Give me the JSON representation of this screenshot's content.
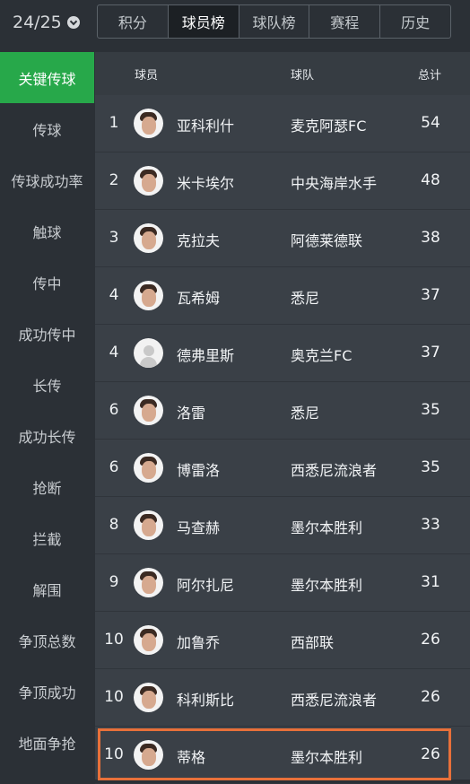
{
  "season": {
    "label": "24/25"
  },
  "tabs": [
    {
      "label": "积分"
    },
    {
      "label": "球员榜"
    },
    {
      "label": "球队榜"
    },
    {
      "label": "赛程"
    },
    {
      "label": "历史"
    }
  ],
  "active_tab": 1,
  "sidebar": {
    "items": [
      {
        "label": "关键传球"
      },
      {
        "label": "传球"
      },
      {
        "label": "传球成功率"
      },
      {
        "label": "触球"
      },
      {
        "label": "传中"
      },
      {
        "label": "成功传中"
      },
      {
        "label": "长传"
      },
      {
        "label": "成功长传"
      },
      {
        "label": "抢断"
      },
      {
        "label": "拦截"
      },
      {
        "label": "解围"
      },
      {
        "label": "争顶总数"
      },
      {
        "label": "争顶成功"
      },
      {
        "label": "地面争抢"
      }
    ]
  },
  "table": {
    "headers": {
      "player": "球员",
      "team": "球队",
      "total": "总计"
    },
    "rows": [
      {
        "rank": "1",
        "name": "亚科利什",
        "team": "麦克阿瑟FC",
        "total": "54"
      },
      {
        "rank": "2",
        "name": "米卡埃尔",
        "team": "中央海岸水手",
        "total": "48"
      },
      {
        "rank": "3",
        "name": "克拉夫",
        "team": "阿德莱德联",
        "total": "38"
      },
      {
        "rank": "4",
        "name": "瓦希姆",
        "team": "悉尼",
        "total": "37"
      },
      {
        "rank": "4",
        "name": "德弗里斯",
        "team": "奥克兰FC",
        "total": "37"
      },
      {
        "rank": "6",
        "name": "洛雷",
        "team": "悉尼",
        "total": "35"
      },
      {
        "rank": "6",
        "name": "博雷洛",
        "team": "西悉尼流浪者",
        "total": "35"
      },
      {
        "rank": "8",
        "name": "马查赫",
        "team": "墨尔本胜利",
        "total": "33"
      },
      {
        "rank": "9",
        "name": "阿尔扎尼",
        "team": "墨尔本胜利",
        "total": "31"
      },
      {
        "rank": "10",
        "name": "加鲁乔",
        "team": "西部联",
        "total": "26"
      },
      {
        "rank": "10",
        "name": "科利斯比",
        "team": "西悉尼流浪者",
        "total": "26"
      },
      {
        "rank": "10",
        "name": "蒂格",
        "team": "墨尔本胜利",
        "total": "26"
      }
    ]
  },
  "icons": {
    "season_dropdown": "chevron-down-icon",
    "avatar": "player-avatar-icon"
  },
  "colors": {
    "accent": "#27a84a",
    "highlight": "#e8703a"
  }
}
